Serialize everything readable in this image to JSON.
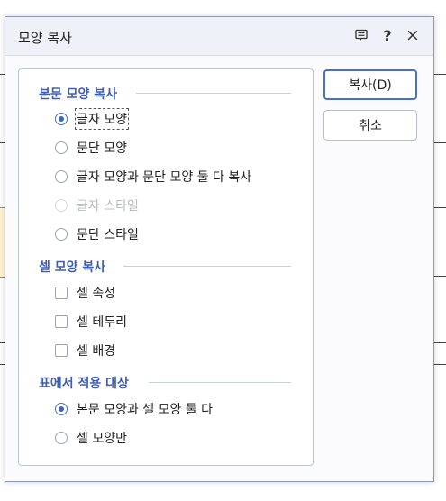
{
  "dialog": {
    "title": "모양 복사",
    "icons": {
      "help_panel": "memo-icon",
      "help": "?",
      "close": "×"
    }
  },
  "sections": {
    "body": {
      "title": "본문 모양 복사",
      "options": [
        {
          "label": "글자 모양",
          "checked": true,
          "disabled": false
        },
        {
          "label": "문단 모양",
          "checked": false,
          "disabled": false
        },
        {
          "label": "글자 모양과 문단 모양 둘 다 복사",
          "checked": false,
          "disabled": false
        },
        {
          "label": "글자 스타일",
          "checked": false,
          "disabled": true
        },
        {
          "label": "문단 스타일",
          "checked": false,
          "disabled": false
        }
      ]
    },
    "cell": {
      "title": "셀 모양 복사",
      "options": [
        {
          "label": "셀 속성",
          "checked": false
        },
        {
          "label": "셀 테두리",
          "checked": false
        },
        {
          "label": "셀 배경",
          "checked": false
        }
      ]
    },
    "table_target": {
      "title": "표에서 적용 대상",
      "options": [
        {
          "label": "본문 모양과 셀 모양 둘 다",
          "checked": true
        },
        {
          "label": "셀 모양만",
          "checked": false
        }
      ]
    }
  },
  "buttons": {
    "copy": "복사(D)",
    "cancel": "취소"
  },
  "colors": {
    "accent": "#3d5fb5",
    "border": "#8b9bbd"
  }
}
